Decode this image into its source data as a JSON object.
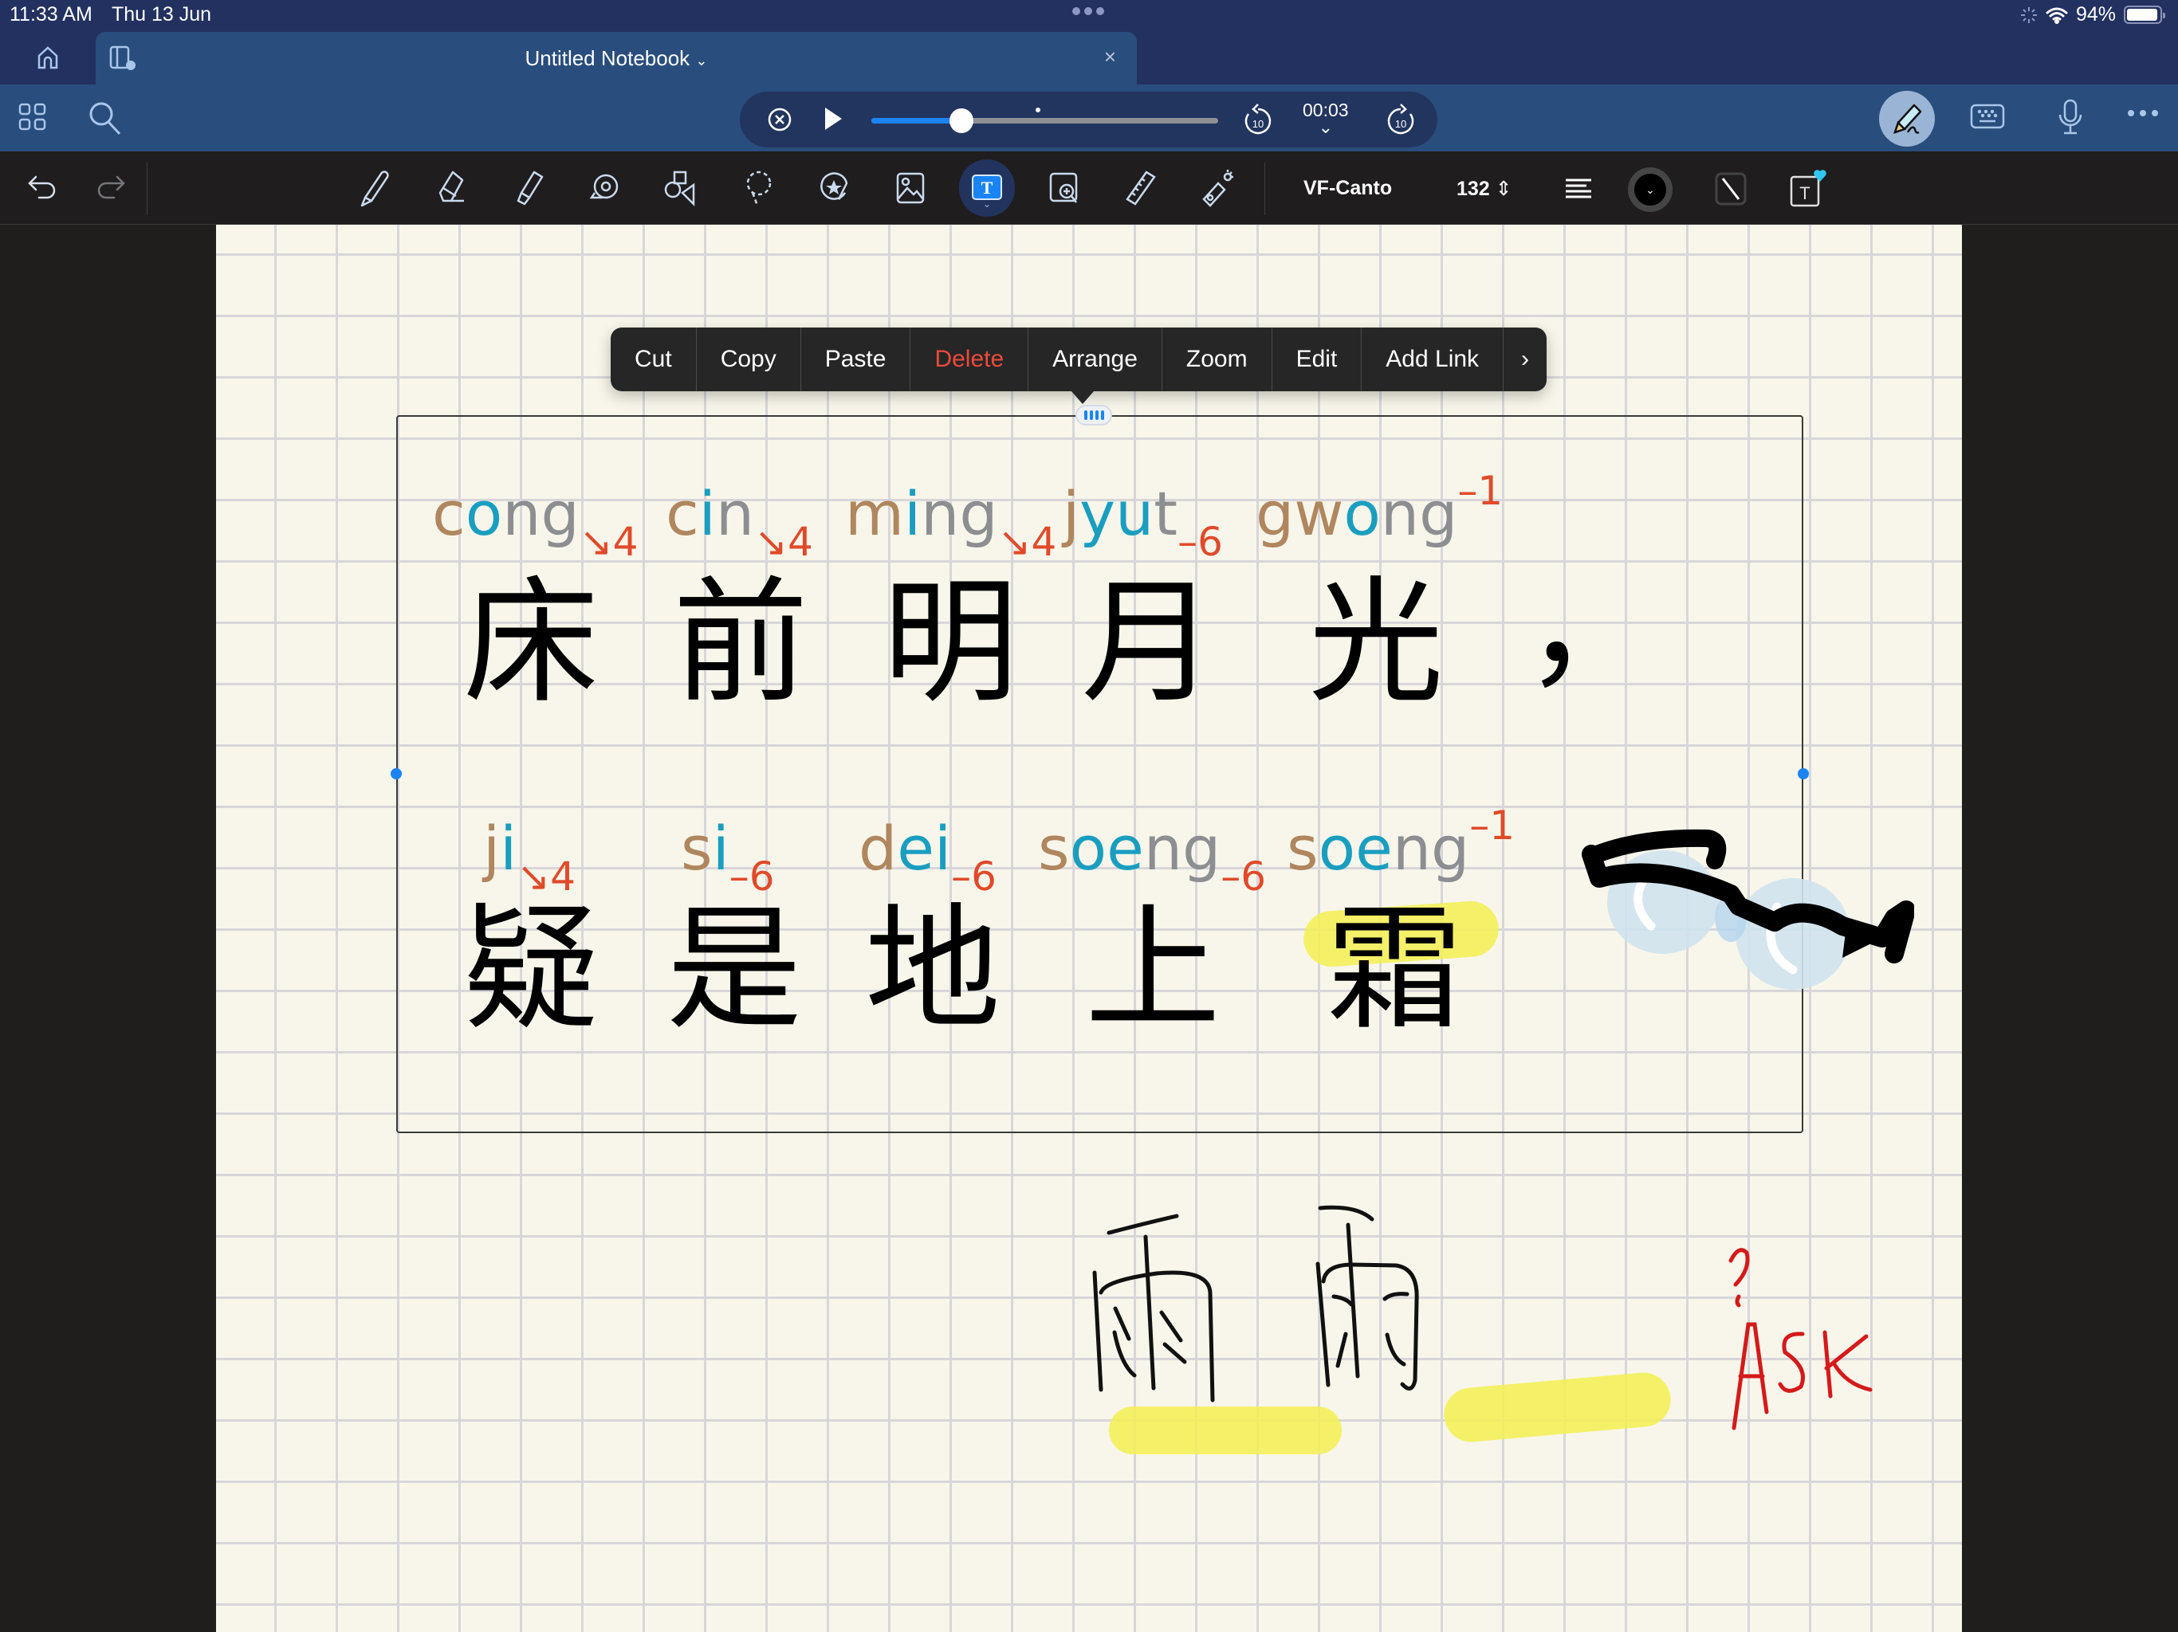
{
  "status_bar": {
    "time": "11:33 AM",
    "date": "Thu 13 Jun",
    "battery_percent": "94%",
    "battery_level": 0.94
  },
  "tab": {
    "title": "Untitled Notebook",
    "close_label": "×"
  },
  "player": {
    "elapsed": "00:03",
    "progress": 0.26,
    "skip_back_label": "10",
    "skip_forward_label": "10"
  },
  "toolbar": {
    "font_name": "VF-Canto",
    "font_size": "132",
    "tools": [
      "pen",
      "eraser",
      "highlighter",
      "tape",
      "shapes",
      "lasso",
      "stickers",
      "image",
      "text",
      "image-search",
      "ruler",
      "laser-pointer"
    ],
    "active_tool": "text"
  },
  "context_menu": {
    "items": [
      "Cut",
      "Copy",
      "Paste",
      "Delete",
      "Arrange",
      "Zoom",
      "Edit",
      "Add Link",
      "›"
    ]
  },
  "poem": {
    "line1": [
      {
        "hanzi": "床",
        "initial": "c",
        "vowel": "o",
        "final": "ng",
        "tone": "4"
      },
      {
        "hanzi": "前",
        "initial": "c",
        "vowel": "i",
        "final": "n",
        "tone": "4"
      },
      {
        "hanzi": "明",
        "initial": "m",
        "vowel": "i",
        "final": "ng",
        "tone": "4"
      },
      {
        "hanzi": "月",
        "initial": "j",
        "vowel": "yu",
        "final": "t",
        "tone": "6"
      },
      {
        "hanzi": "光",
        "initial": "gw",
        "vowel": "o",
        "final": "ng",
        "tone": "1"
      }
    ],
    "line1_punct": "，",
    "line2": [
      {
        "hanzi": "疑",
        "initial": "j",
        "vowel": "i",
        "final": "",
        "tone": "4"
      },
      {
        "hanzi": "是",
        "initial": "s",
        "vowel": "i",
        "final": "",
        "tone": "6"
      },
      {
        "hanzi": "地",
        "initial": "d",
        "vowel": "ei",
        "final": "",
        "tone": "6"
      },
      {
        "hanzi": "上",
        "initial": "s",
        "vowel": "oe",
        "final": "ng",
        "tone": "6"
      },
      {
        "hanzi": "霜",
        "initial": "s",
        "vowel": "oe",
        "final": "ng",
        "tone": "1"
      }
    ]
  },
  "annotations": {
    "handwritten_chars": [
      "雨",
      "雨"
    ],
    "note_question": "?",
    "note_text": "ASK"
  },
  "colors": {
    "initial": "#b0865e",
    "vowel": "#1a9ec0",
    "final": "#8c8e91",
    "tone": "#e04a2a",
    "highlight": "#f3f052",
    "accent": "#1b84f5",
    "note_red": "#d41a1a"
  }
}
